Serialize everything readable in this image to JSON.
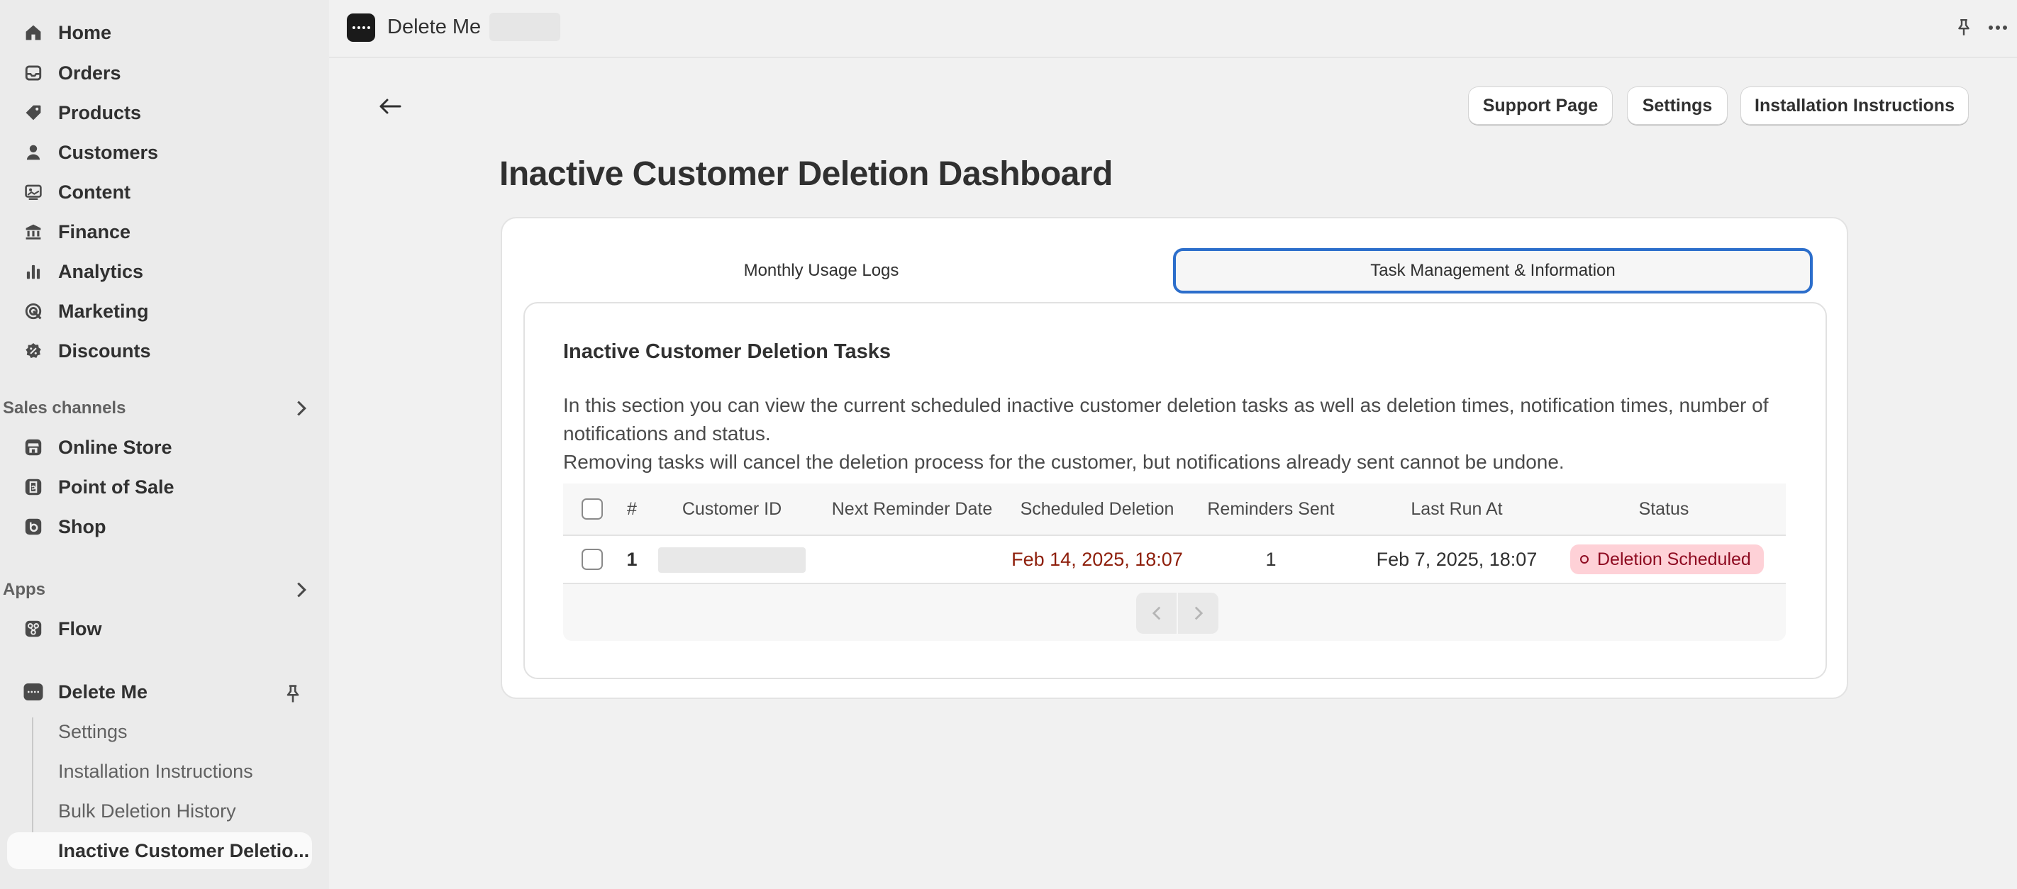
{
  "sidebar": {
    "main_items": [
      {
        "label": "Home",
        "icon": "home-icon"
      },
      {
        "label": "Orders",
        "icon": "inbox-icon"
      },
      {
        "label": "Products",
        "icon": "tag-icon"
      },
      {
        "label": "Customers",
        "icon": "person-icon"
      },
      {
        "label": "Content",
        "icon": "image-icon"
      },
      {
        "label": "Finance",
        "icon": "bank-icon"
      },
      {
        "label": "Analytics",
        "icon": "bar-chart-icon"
      },
      {
        "label": "Marketing",
        "icon": "target-icon"
      },
      {
        "label": "Discounts",
        "icon": "discount-icon"
      }
    ],
    "sales_channels": {
      "heading": "Sales channels",
      "items": [
        {
          "label": "Online Store",
          "icon": "store-icon"
        },
        {
          "label": "Point of Sale",
          "icon": "pos-icon"
        },
        {
          "label": "Shop",
          "icon": "shop-icon"
        }
      ]
    },
    "apps": {
      "heading": "Apps",
      "items": [
        {
          "label": "Flow",
          "icon": "flow-icon"
        }
      ]
    },
    "app": {
      "label": "Delete Me",
      "icon": "app-dots-icon",
      "sub_items": [
        {
          "label": "Settings"
        },
        {
          "label": "Installation Instructions"
        },
        {
          "label": "Bulk Deletion History"
        },
        {
          "label": "Inactive Customer Deletio..."
        }
      ]
    }
  },
  "topbar": {
    "title": "Delete Me"
  },
  "header": {
    "buttons": {
      "support": "Support Page",
      "settings": "Settings",
      "installation": "Installation Instructions"
    },
    "title": "Inactive Customer Deletion Dashboard"
  },
  "tabs": [
    {
      "label": "Monthly Usage Logs",
      "selected": false
    },
    {
      "label": "Task Management & Information",
      "selected": true
    }
  ],
  "section": {
    "title": "Inactive Customer Deletion Tasks",
    "description_line1": "In this section you can view the current scheduled inactive customer deletion tasks as well as deletion times, notification times, number of notifications and status.",
    "description_line2": "Removing tasks will cancel the deletion process for the customer, but notifications already sent cannot be undone."
  },
  "table": {
    "columns": {
      "index": "#",
      "customer_id": "Customer ID",
      "next_reminder": "Next Reminder Date",
      "scheduled_deletion": "Scheduled Deletion",
      "reminders_sent": "Reminders Sent",
      "last_run": "Last Run At",
      "status": "Status"
    },
    "rows": [
      {
        "index": "1",
        "customer_id": "",
        "next_reminder": "",
        "scheduled_deletion": "Feb 14, 2025, 18:07",
        "reminders_sent": "1",
        "last_run": "Feb 7, 2025, 18:07",
        "status": "Deletion Scheduled"
      }
    ]
  },
  "colors": {
    "accent": "#2c6ecb",
    "deletion_date": "#8e1f0b",
    "badge_bg": "#fed1d7",
    "badge_text": "#8e0b21"
  }
}
